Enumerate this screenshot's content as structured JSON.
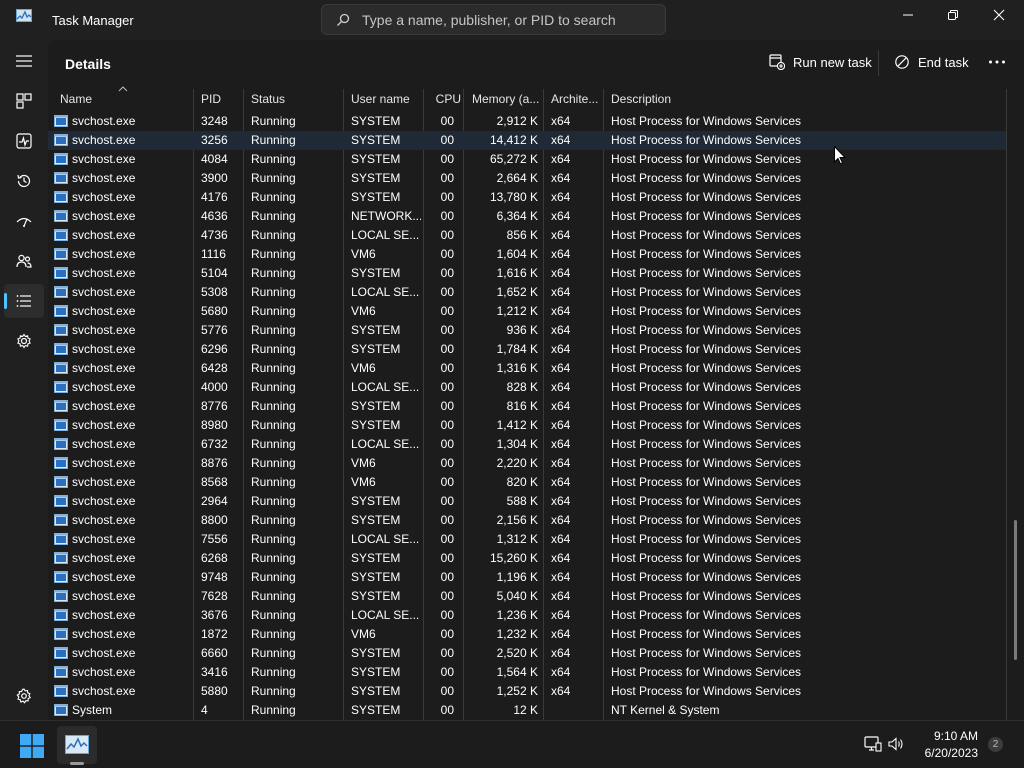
{
  "window": {
    "title": "Task Manager"
  },
  "search": {
    "placeholder": "Type a name, publisher, or PID to search"
  },
  "page": {
    "title": "Details"
  },
  "toolbar": {
    "run_new_task": "Run new task",
    "end_task": "End task"
  },
  "columns": [
    "Name",
    "PID",
    "Status",
    "User name",
    "CPU",
    "Memory (a...",
    "Archite...",
    "Description"
  ],
  "rows": [
    [
      "svchost.exe",
      "3248",
      "Running",
      "SYSTEM",
      "00",
      "2,912 K",
      "x64",
      "Host Process for Windows Services"
    ],
    [
      "svchost.exe",
      "3256",
      "Running",
      "SYSTEM",
      "00",
      "14,412 K",
      "x64",
      "Host Process for Windows Services"
    ],
    [
      "svchost.exe",
      "4084",
      "Running",
      "SYSTEM",
      "00",
      "65,272 K",
      "x64",
      "Host Process for Windows Services"
    ],
    [
      "svchost.exe",
      "3900",
      "Running",
      "SYSTEM",
      "00",
      "2,664 K",
      "x64",
      "Host Process for Windows Services"
    ],
    [
      "svchost.exe",
      "4176",
      "Running",
      "SYSTEM",
      "00",
      "13,780 K",
      "x64",
      "Host Process for Windows Services"
    ],
    [
      "svchost.exe",
      "4636",
      "Running",
      "NETWORK...",
      "00",
      "6,364 K",
      "x64",
      "Host Process for Windows Services"
    ],
    [
      "svchost.exe",
      "4736",
      "Running",
      "LOCAL SE...",
      "00",
      "856 K",
      "x64",
      "Host Process for Windows Services"
    ],
    [
      "svchost.exe",
      "1116",
      "Running",
      "VM6",
      "00",
      "1,604 K",
      "x64",
      "Host Process for Windows Services"
    ],
    [
      "svchost.exe",
      "5104",
      "Running",
      "SYSTEM",
      "00",
      "1,616 K",
      "x64",
      "Host Process for Windows Services"
    ],
    [
      "svchost.exe",
      "5308",
      "Running",
      "LOCAL SE...",
      "00",
      "1,652 K",
      "x64",
      "Host Process for Windows Services"
    ],
    [
      "svchost.exe",
      "5680",
      "Running",
      "VM6",
      "00",
      "1,212 K",
      "x64",
      "Host Process for Windows Services"
    ],
    [
      "svchost.exe",
      "5776",
      "Running",
      "SYSTEM",
      "00",
      "936 K",
      "x64",
      "Host Process for Windows Services"
    ],
    [
      "svchost.exe",
      "6296",
      "Running",
      "SYSTEM",
      "00",
      "1,784 K",
      "x64",
      "Host Process for Windows Services"
    ],
    [
      "svchost.exe",
      "6428",
      "Running",
      "VM6",
      "00",
      "1,316 K",
      "x64",
      "Host Process for Windows Services"
    ],
    [
      "svchost.exe",
      "4000",
      "Running",
      "LOCAL SE...",
      "00",
      "828 K",
      "x64",
      "Host Process for Windows Services"
    ],
    [
      "svchost.exe",
      "8776",
      "Running",
      "SYSTEM",
      "00",
      "816 K",
      "x64",
      "Host Process for Windows Services"
    ],
    [
      "svchost.exe",
      "8980",
      "Running",
      "SYSTEM",
      "00",
      "1,412 K",
      "x64",
      "Host Process for Windows Services"
    ],
    [
      "svchost.exe",
      "6732",
      "Running",
      "LOCAL SE...",
      "00",
      "1,304 K",
      "x64",
      "Host Process for Windows Services"
    ],
    [
      "svchost.exe",
      "8876",
      "Running",
      "VM6",
      "00",
      "2,220 K",
      "x64",
      "Host Process for Windows Services"
    ],
    [
      "svchost.exe",
      "8568",
      "Running",
      "VM6",
      "00",
      "820 K",
      "x64",
      "Host Process for Windows Services"
    ],
    [
      "svchost.exe",
      "2964",
      "Running",
      "SYSTEM",
      "00",
      "588 K",
      "x64",
      "Host Process for Windows Services"
    ],
    [
      "svchost.exe",
      "8800",
      "Running",
      "SYSTEM",
      "00",
      "2,156 K",
      "x64",
      "Host Process for Windows Services"
    ],
    [
      "svchost.exe",
      "7556",
      "Running",
      "LOCAL SE...",
      "00",
      "1,312 K",
      "x64",
      "Host Process for Windows Services"
    ],
    [
      "svchost.exe",
      "6268",
      "Running",
      "SYSTEM",
      "00",
      "15,260 K",
      "x64",
      "Host Process for Windows Services"
    ],
    [
      "svchost.exe",
      "9748",
      "Running",
      "SYSTEM",
      "00",
      "1,196 K",
      "x64",
      "Host Process for Windows Services"
    ],
    [
      "svchost.exe",
      "7628",
      "Running",
      "SYSTEM",
      "00",
      "5,040 K",
      "x64",
      "Host Process for Windows Services"
    ],
    [
      "svchost.exe",
      "3676",
      "Running",
      "LOCAL SE...",
      "00",
      "1,236 K",
      "x64",
      "Host Process for Windows Services"
    ],
    [
      "svchost.exe",
      "1872",
      "Running",
      "VM6",
      "00",
      "1,232 K",
      "x64",
      "Host Process for Windows Services"
    ],
    [
      "svchost.exe",
      "6660",
      "Running",
      "SYSTEM",
      "00",
      "2,520 K",
      "x64",
      "Host Process for Windows Services"
    ],
    [
      "svchost.exe",
      "3416",
      "Running",
      "SYSTEM",
      "00",
      "1,564 K",
      "x64",
      "Host Process for Windows Services"
    ],
    [
      "svchost.exe",
      "5880",
      "Running",
      "SYSTEM",
      "00",
      "1,252 K",
      "x64",
      "Host Process for Windows Services"
    ],
    [
      "System",
      "4",
      "Running",
      "SYSTEM",
      "00",
      "12 K",
      "",
      "NT Kernel & System"
    ]
  ],
  "selected_row": 1,
  "nav": {
    "items": [
      "hamburger-icon",
      "processes-icon",
      "performance-icon",
      "app-history-icon",
      "startup-apps-icon",
      "users-icon",
      "details-icon",
      "services-icon"
    ],
    "active": "details-icon",
    "settings": "settings-icon"
  },
  "taskbar": {
    "time": "9:10 AM",
    "date": "6/20/2023",
    "badge": "2"
  },
  "colors": {
    "accent": "#4cc2ff",
    "background": "#202020",
    "panel": "#1c1c1c",
    "selected_row": "#1f2a36"
  }
}
